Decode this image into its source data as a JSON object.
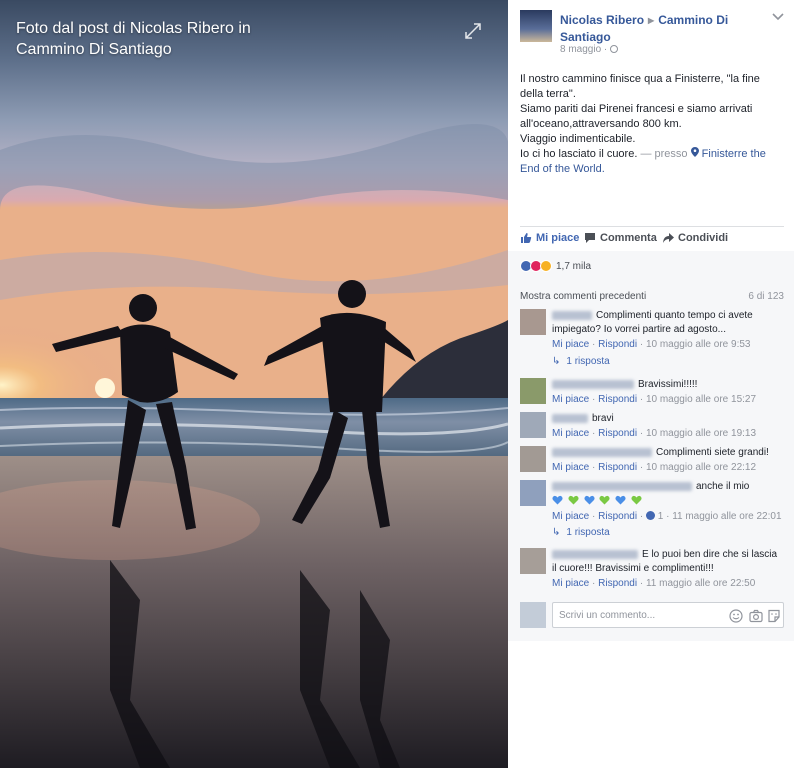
{
  "photo": {
    "title": "Foto dal post di Nicolas Ribero in Cammino Di Santiago"
  },
  "post": {
    "author": "Nicolas Ribero",
    "group": "Cammino Di Santiago",
    "date": "8 maggio",
    "lines": [
      "Il nostro cammino finisce qua a Finisterre, \"la fine della terra\".",
      "Siamo pariti dai Pirenei francesi e siamo arrivati all'oceano,attraversando 800 km.",
      "Viaggio indimenticabile.",
      "Io ci ho lasciato il cuore."
    ],
    "presso": "— presso",
    "place": "Finisterre the End of the World."
  },
  "actions": {
    "like": "Mi piace",
    "comment": "Commenta",
    "share": "Condividi"
  },
  "reactions": {
    "count": "1,7 mila"
  },
  "comments_header": {
    "prev_label": "Mostra commenti precedenti",
    "count": "6 di 123"
  },
  "comments": [
    {
      "text": "Complimenti quanto tempo ci avete impiegato? Io vorrei partire ad agosto...",
      "like": "Mi piace",
      "reply": "Rispondi",
      "time": "10 maggio alle ore 9:53"
    },
    {
      "text": "Bravissimi!!!!!",
      "like": "Mi piace",
      "reply": "Rispondi",
      "time": "10 maggio alle ore 15:27"
    },
    {
      "text": "bravi",
      "like": "Mi piace",
      "reply": "Rispondi",
      "time": "10 maggio alle ore 19:13"
    },
    {
      "text": "Complimenti siete grandi!",
      "like": "Mi piace",
      "reply": "Rispondi",
      "time": "10 maggio alle ore 22:12"
    },
    {
      "text": "anche il mio",
      "like": "Mi piace",
      "reply": "Rispondi",
      "likes": "1",
      "time": "11 maggio alle ore 22:01"
    },
    {
      "text": "E lo puoi ben dire che si lascia il cuore!!! Bravissimi e complimenti!!!",
      "like": "Mi piace",
      "reply": "Rispondi",
      "time": "11 maggio alle ore 22:50"
    }
  ],
  "replies": {
    "first": "1 risposta",
    "fifth": "1 risposta"
  },
  "write_comment": {
    "placeholder": "Scrivi un commento..."
  },
  "colors": {
    "link": "#365899",
    "action_blue": "#4267b2",
    "muted": "#90949c"
  }
}
